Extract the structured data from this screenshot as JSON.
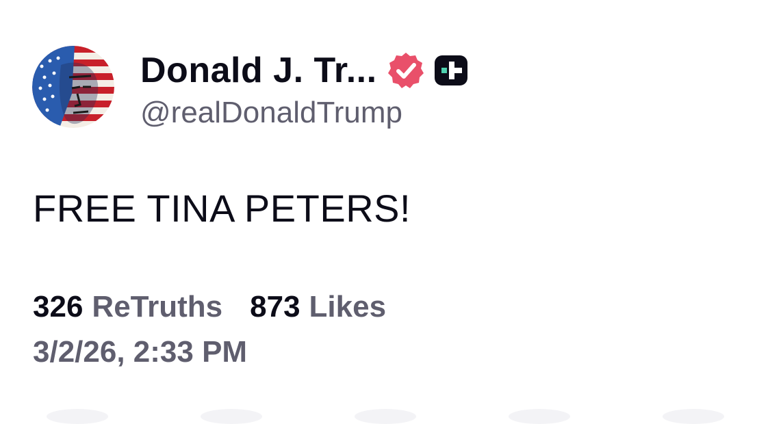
{
  "author": {
    "display_name": "Donald J. Tr...",
    "handle": "@realDonaldTrump",
    "avatar_icon": "flag-portrait-avatar",
    "verified_icon": "verified-badge-icon",
    "verified_color": "#e9506a",
    "truth_plus_icon": "truth-plus-icon",
    "truth_plus_color": "#0c0c18",
    "truth_plus_accent": "#4fd2b0"
  },
  "post": {
    "text": "FREE TINA PETERS!"
  },
  "stats": {
    "retruths_count": "326",
    "retruths_label": "ReTruths",
    "likes_count": "873",
    "likes_label": "Likes"
  },
  "timestamp": "3/2/26, 2:33 PM",
  "colors": {
    "text_primary": "#0c0c18",
    "text_secondary": "#5f5e6e",
    "background": "#ffffff"
  }
}
